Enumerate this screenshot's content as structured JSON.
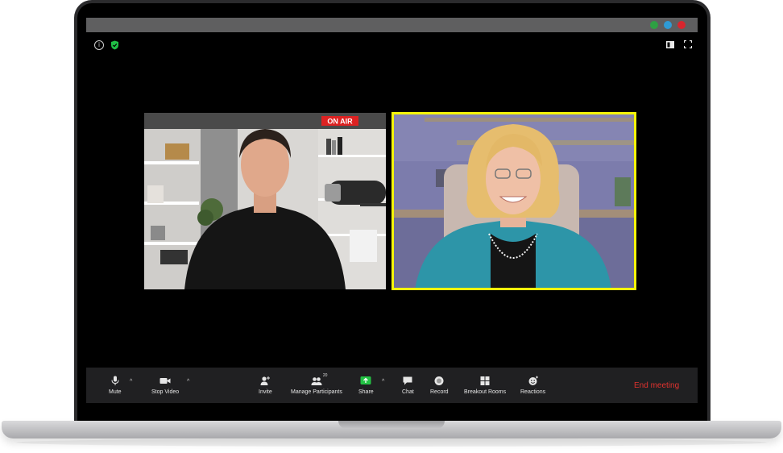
{
  "window": {
    "traffic_lights": [
      "#2ea043",
      "#2f9bd5",
      "#d8262e"
    ]
  },
  "header": {
    "info_glyph": "i"
  },
  "videos": {
    "left_sign": "ON AIR"
  },
  "toolbar": {
    "mute_label": "Mute",
    "stop_video_label": "Stop Video",
    "invite_label": "Invite",
    "participants_label": "Manage Participants",
    "participants_count": "20",
    "share_label": "Share",
    "chat_label": "Chat",
    "record_label": "Record",
    "breakout_label": "Breakout Rooms",
    "reactions_label": "Reactions",
    "end_label": "End meeting",
    "caret_glyph": "^"
  },
  "colors": {
    "active_speaker": "#f5f50a",
    "end_meeting": "#e0322e",
    "share_green": "#23c244"
  }
}
